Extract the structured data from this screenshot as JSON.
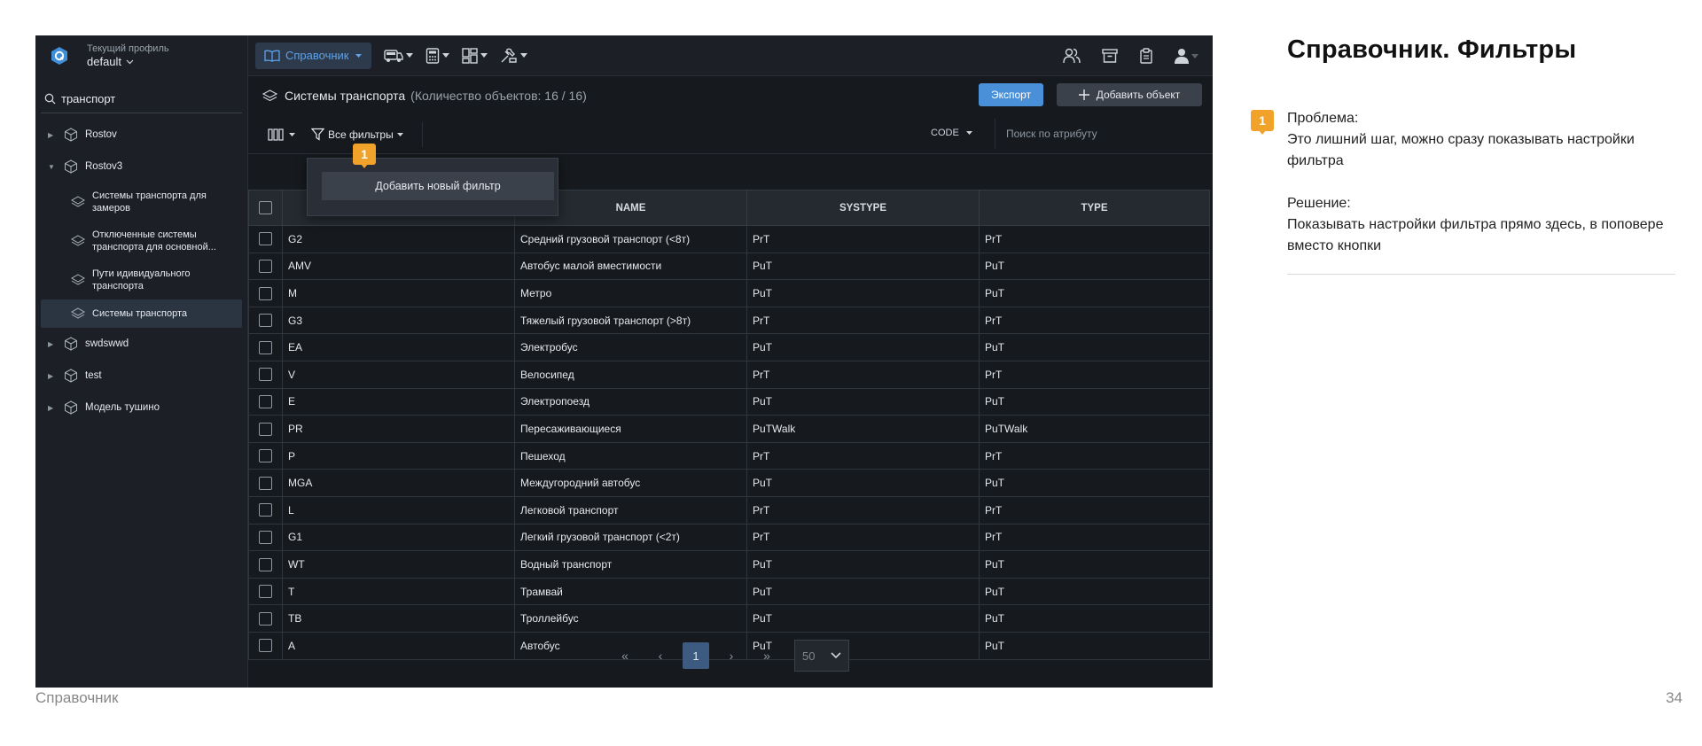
{
  "sidebar": {
    "profile_label": "Текущий профиль",
    "profile_name": "default",
    "search_value": "транспорт",
    "tree": [
      {
        "label": "Rostov",
        "expanded": false
      },
      {
        "label": "Rostov3",
        "expanded": true
      },
      {
        "label": "Системы транспорта для замеров"
      },
      {
        "label": "Отключенные системы транспорта для основной..."
      },
      {
        "label": "Пути идивидуального транспорта"
      },
      {
        "label": "Системы транспорта",
        "active": true
      },
      {
        "label": "swdswwd",
        "expanded": false
      },
      {
        "label": "test",
        "expanded": false
      },
      {
        "label": "Модель тушино",
        "expanded": false
      }
    ]
  },
  "topbar": {
    "reference_label": "Справочник"
  },
  "header": {
    "title": "Системы транспорта",
    "count": "(Количество объектов: 16 / 16)",
    "export_label": "Экспорт",
    "add_label": "Добавить объект"
  },
  "toolbar": {
    "filters_label": "Все фильтры",
    "attribute": "CODE",
    "search_placeholder": "Поиск по атрибуту"
  },
  "table": {
    "columns": [
      "",
      "NAME",
      "SYSTYPE",
      "TYPE"
    ],
    "rows": [
      [
        "G2",
        "Средний грузовой транспорт (<8т)",
        "PrT",
        "PrT"
      ],
      [
        "AMV",
        "Автобус малой вместимости",
        "PuT",
        "PuT"
      ],
      [
        "M",
        "Метро",
        "PuT",
        "PuT"
      ],
      [
        "G3",
        "Тяжелый грузовой транспорт (>8т)",
        "PrT",
        "PrT"
      ],
      [
        "EA",
        "Электробус",
        "PuT",
        "PuT"
      ],
      [
        "V",
        "Велосипед",
        "PrT",
        "PrT"
      ],
      [
        "E",
        "Электропоезд",
        "PuT",
        "PuT"
      ],
      [
        "PR",
        "Пересаживающиеся",
        "PuTWalk",
        "PuTWalk"
      ],
      [
        "P",
        "Пешеход",
        "PrT",
        "PrT"
      ],
      [
        "MGA",
        "Междугородний автобус",
        "PuT",
        "PuT"
      ],
      [
        "L",
        "Легковой транспорт",
        "PrT",
        "PrT"
      ],
      [
        "G1",
        "Легкий грузовой транспорт (<2т)",
        "PrT",
        "PrT"
      ],
      [
        "WT",
        "Водный транспорт",
        "PuT",
        "PuT"
      ],
      [
        "T",
        "Трамвай",
        "PuT",
        "PuT"
      ],
      [
        "TB",
        "Троллейбус",
        "PuT",
        "PuT"
      ],
      [
        "A",
        "Автобус",
        "PuT",
        "PuT"
      ]
    ]
  },
  "pagination": {
    "first": "«",
    "prev": "‹",
    "current": "1",
    "next": "›",
    "last": "»",
    "page_size": "50"
  },
  "popover": {
    "marker": "1",
    "button_label": "Добавить новый фильтр"
  },
  "notes": {
    "title": "Справочник. Фильтры",
    "marker": "1",
    "problem_heading": "Проблема:",
    "problem_text": "Это лишний шаг, можно сразу показывать настройки фильтра",
    "solution_heading": "Решение:",
    "solution_text": "Показывать настройки фильтра прямо здесь, в поповере вместо кнопки"
  },
  "footer": {
    "section": "Справочник",
    "page_number": "34"
  },
  "colors": {
    "accent": "#4a90d9",
    "marker": "#f0a22a",
    "app_bg": "#16191d"
  }
}
